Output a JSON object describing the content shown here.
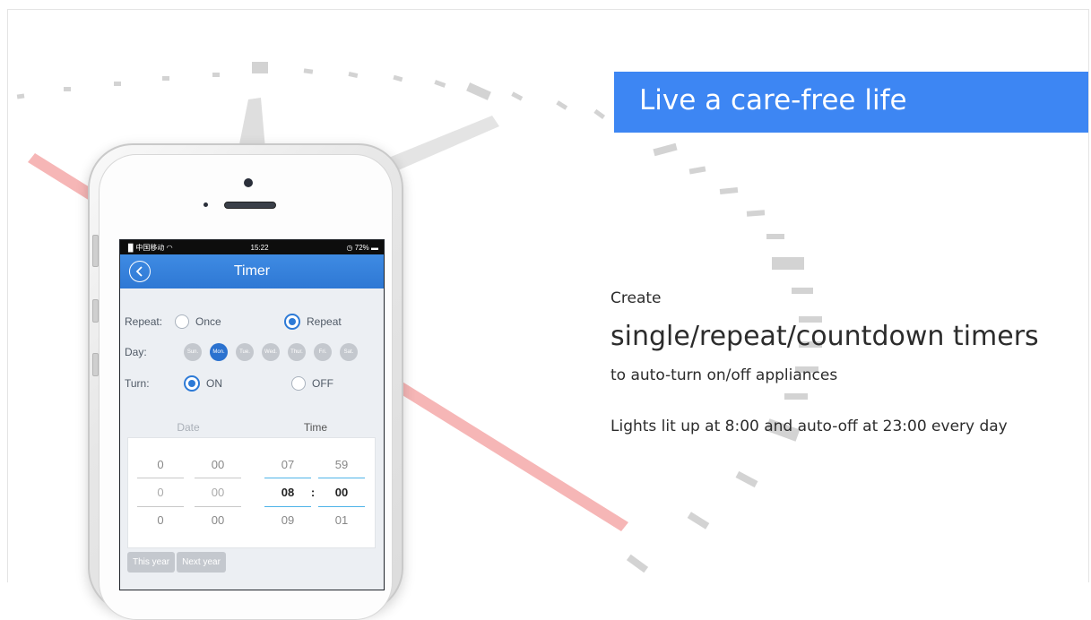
{
  "banner": {
    "title": "Live a care-free life"
  },
  "copy": {
    "create": "Create",
    "headline": "single/repeat/countdown timers",
    "subline": "to auto-turn on/off appliances",
    "example": "Lights lit up at 8:00 and auto-off at 23:00 every day"
  },
  "phone": {
    "status": {
      "carrier": "中国移动",
      "time": "15:22",
      "battery": "72%"
    },
    "app_title": "Timer",
    "repeat": {
      "label": "Repeat:",
      "once": "Once",
      "repeat": "Repeat",
      "selected": "Repeat"
    },
    "day": {
      "label": "Day:",
      "days": [
        "Sun.",
        "Mon.",
        "Tue.",
        "Wed.",
        "Thur.",
        "Fri.",
        "Sat."
      ],
      "selected": "Mon."
    },
    "turn": {
      "label": "Turn:",
      "on": "ON",
      "off": "OFF",
      "selected": "ON"
    },
    "picker": {
      "date_label": "Date",
      "time_label": "Time",
      "date_col1": [
        "0",
        "0",
        "0"
      ],
      "date_col2": [
        "00",
        "00",
        "00"
      ],
      "hour": [
        "07",
        "08",
        "09"
      ],
      "minute": [
        "59",
        "00",
        "01"
      ],
      "separator": ":"
    },
    "year_buttons": [
      "This year",
      "Next year"
    ]
  },
  "colors": {
    "banner": "#3d86f3",
    "app_bar": "#2e78d4",
    "accent": "#2d7ad6",
    "clock_hand": "#f4a9a9"
  },
  "icons": {
    "back": "chevron-left-circle-icon",
    "wifi": "wifi-icon",
    "battery": "battery-icon",
    "alarm": "alarm-icon"
  }
}
